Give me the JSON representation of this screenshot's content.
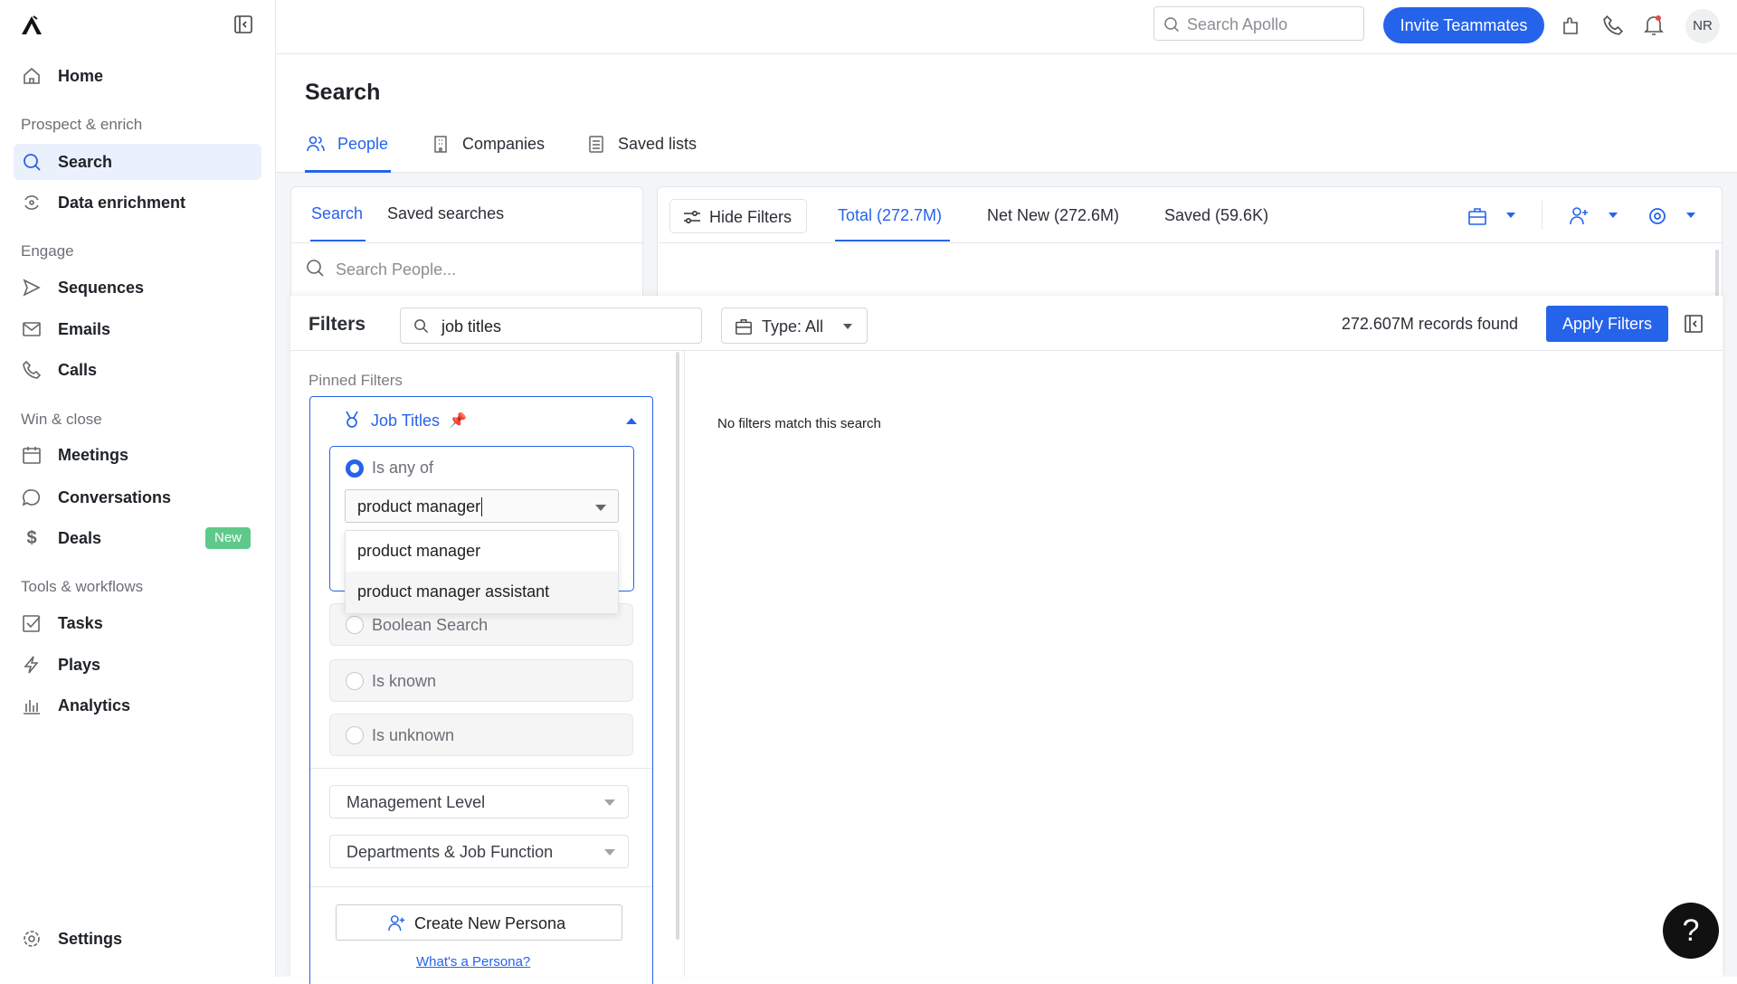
{
  "sidebar": {
    "items": {
      "home": "Home",
      "search": "Search",
      "enrich": "Data enrichment",
      "sequences": "Sequences",
      "emails": "Emails",
      "calls": "Calls",
      "meetings": "Meetings",
      "conversations": "Conversations",
      "deals": "Deals",
      "tasks": "Tasks",
      "plays": "Plays",
      "analytics": "Analytics",
      "settings": "Settings"
    },
    "sections": {
      "prospect": "Prospect & enrich",
      "engage": "Engage",
      "win": "Win & close",
      "tools": "Tools & workflows"
    },
    "deals_badge": "New"
  },
  "topbar": {
    "search_placeholder": "Search Apollo",
    "invite": "Invite Teammates",
    "avatar": "NR"
  },
  "page": {
    "title": "Search",
    "tabs": {
      "people": "People",
      "companies": "Companies",
      "saved_lists": "Saved lists"
    }
  },
  "left_card": {
    "tab_search": "Search",
    "tab_saved": "Saved searches",
    "search_placeholder": "Search People..."
  },
  "results": {
    "hide_filters": "Hide Filters",
    "total": "Total (272.7M)",
    "net_new": "Net New (272.6M)",
    "saved": "Saved (59.6K)"
  },
  "filters": {
    "title": "Filters",
    "search_value": "job titles",
    "type": "Type: All",
    "records": "272.607M records found",
    "apply": "Apply Filters",
    "pinned": "Pinned Filters",
    "job_titles": "Job Titles",
    "is_any_of": "Is any of",
    "input_value": "product manager",
    "suggestions": [
      "product manager",
      "product manager assistant"
    ],
    "boolean": "Boolean Search",
    "is_known": "Is known",
    "is_unknown": "Is unknown",
    "management": "Management Level",
    "departments": "Departments & Job Function",
    "create_persona": "Create New Persona",
    "whats_persona": "What's a Persona?",
    "no_match": "No filters match this search"
  },
  "help": "?",
  "colors": {
    "accent": "#2563eb",
    "active_bg": "#ebf0fd",
    "badge": "#5fc98b"
  }
}
